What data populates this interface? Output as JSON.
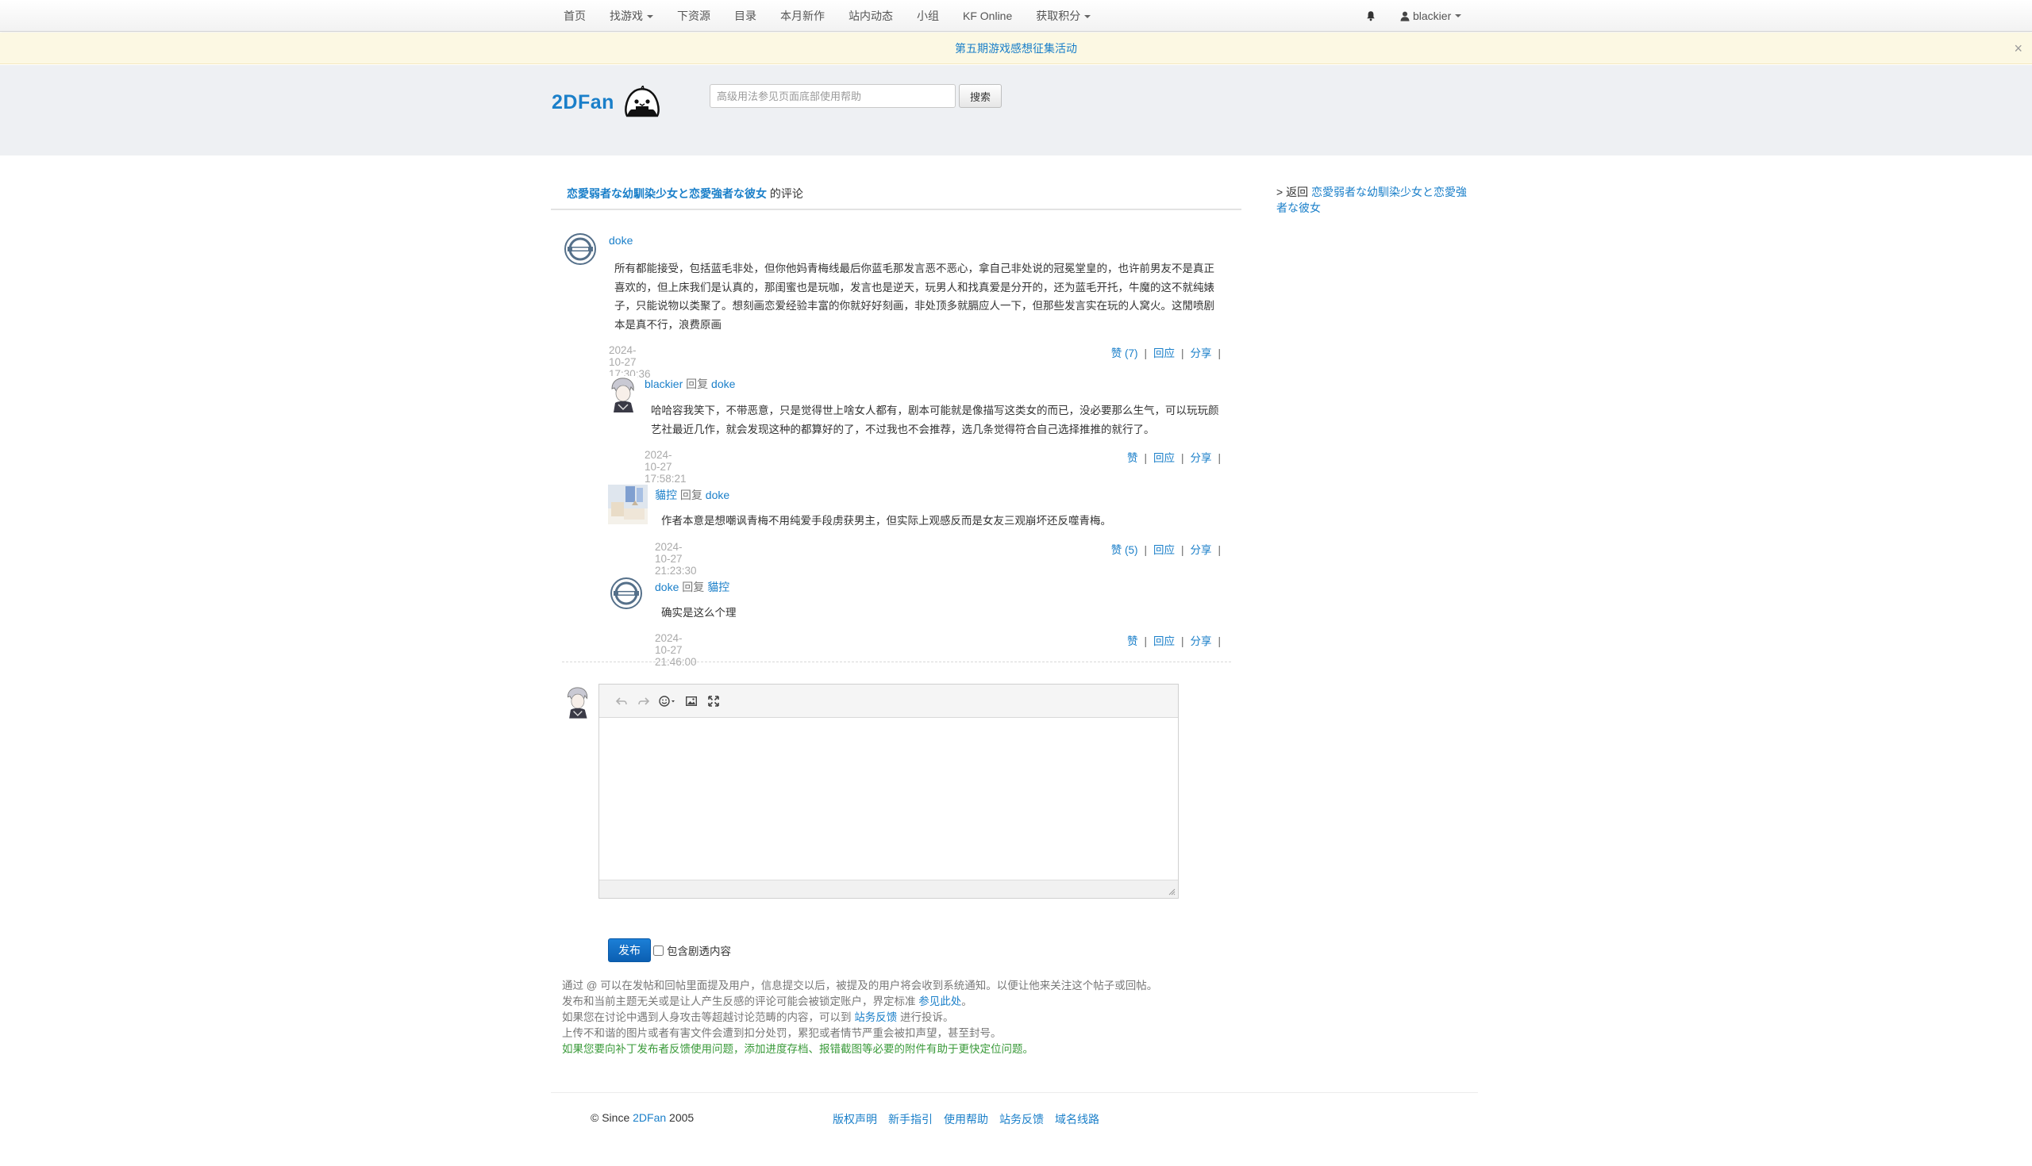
{
  "nav": {
    "items": [
      {
        "label": "首页",
        "dropdown": false
      },
      {
        "label": "找游戏",
        "dropdown": true
      },
      {
        "label": "下资源",
        "dropdown": false
      },
      {
        "label": "目录",
        "dropdown": false
      },
      {
        "label": "本月新作",
        "dropdown": false
      },
      {
        "label": "站内动态",
        "dropdown": false
      },
      {
        "label": "小组",
        "dropdown": false
      },
      {
        "label": "KF Online",
        "dropdown": false
      },
      {
        "label": "获取积分",
        "dropdown": true
      }
    ],
    "notification_icon": "bell-icon",
    "user_icon": "user-icon",
    "username": "blackier"
  },
  "notice": {
    "text": "第五期游戏感想征集活动",
    "close": "×"
  },
  "header": {
    "logo_text": "2DFan",
    "search_placeholder": "高级用法参见页面底部使用帮助",
    "search_button": "搜索"
  },
  "title": {
    "game": "恋愛弱者な幼馴染少女と恋愛強者な彼女",
    "suffix": "的评论"
  },
  "sidebar": {
    "prefix": "> 返回",
    "back_link": "恋愛弱者な幼馴染少女と恋愛強者な彼女"
  },
  "comments": [
    {
      "author": "doke",
      "body": "所有都能接受，包括蓝毛非处，但你他妈青梅线最后你蓝毛那发言恶不恶心，拿自己非处说的冠冕堂皇的，也许前男友不是真正喜欢的，但上床我们是认真的，那闺蜜也是玩咖，发言也是逆天，玩男人和找真爱是分开的，还为蓝毛开托，牛魔的这不就纯婊子，只能说物以类聚了。想刻画恋爱经验丰富的你就好好刻画，非处顶多就膈应人一下，但那些发言实在玩的人窝火。这閒喷剧本是真不行，浪费原画",
      "time": "2024-10-27 17:30:36",
      "like": "赞 (7)",
      "reply": "回应",
      "share": "分享"
    },
    {
      "author": "blackier",
      "reply_word": "回复",
      "reply_to": "doke",
      "body": "哈哈容我笑下，不带恶意，只是觉得世上啥女人都有，剧本可能就是像描写这类女的而已，没必要那么生气，可以玩玩颜艺社最近几作，就会发现这种的都算好的了，不过我也不会推荐，选几条觉得符合自己选择推推的就行了。",
      "time": "2024-10-27 17:58:21",
      "like": "赞",
      "reply": "回应",
      "share": "分享"
    },
    {
      "author": "貓控",
      "reply_word": "回复",
      "reply_to": "doke",
      "body": "作者本意是想嘲讽青梅不用纯爱手段虏获男主，但实际上观感反而是女友三观崩坏还反噬青梅。",
      "time": "2024-10-27 21:23:30",
      "like": "赞 (5)",
      "reply": "回应",
      "share": "分享"
    },
    {
      "author": "doke",
      "reply_word": "回复",
      "reply_to": "貓控",
      "body": "确实是这么个理",
      "time": "2024-10-27 21:46:00",
      "like": "赞",
      "reply": "回应",
      "share": "分享"
    }
  ],
  "editor": {
    "tools": [
      "undo-icon",
      "redo-icon",
      "emoji-icon",
      "image-icon",
      "fullscreen-icon"
    ],
    "publish": "发布",
    "spoiler_label": "包含剧透内容"
  },
  "tips": {
    "line1": "通过 @ 可以在发帖和回帖里面提及用户，信息提交以后，被提及的用户将会收到系统通知。以便让他来关注这个帖子或回帖。",
    "line2_pre": "发布和当前主题无关或是让人产生反感的评论可能会被锁定账户，界定标准",
    "line2_link": "参见此处",
    "line2_post": "。",
    "line3_pre": "如果您在讨论中遇到人身攻击等超越讨论范畴的内容，可以到",
    "line3_link": "站务反馈",
    "line3_post": "进行投诉。",
    "line4": "上传不和谐的图片或者有害文件会遭到扣分处罚，累犯或者情节严重会被扣声望，甚至封号。",
    "line5": "如果您要向补丁发布者反馈使用问题，添加进度存档、报错截图等必要的附件有助于更快定位问题。"
  },
  "footer": {
    "copyright_pre": "© Since",
    "brand": "2DFan",
    "year": "2005",
    "links": [
      "版权声明",
      "新手指引",
      "使用帮助",
      "站务反馈",
      "域名线路"
    ]
  },
  "colors": {
    "link": "#1a7fc9",
    "notice_bg": "#fcf8e3",
    "header_bg": "#eef0f3",
    "publish_button": "#0b5fb2",
    "tip_green": "#3a9a3a"
  }
}
